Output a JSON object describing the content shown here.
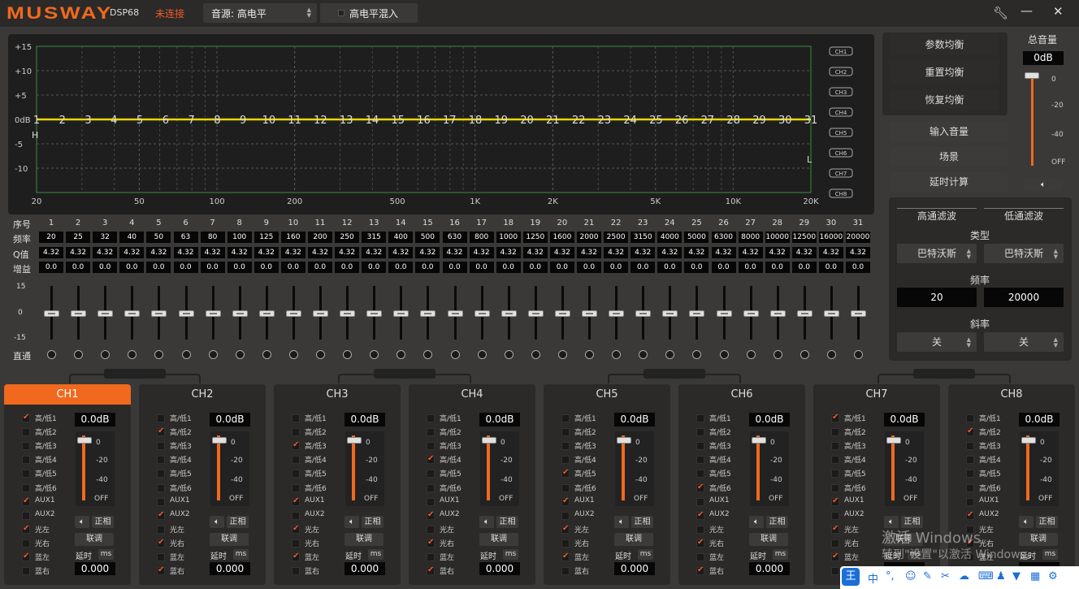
{
  "app": {
    "brand": "MUSWAY",
    "model": "DSP68",
    "status": "未连接"
  },
  "source": {
    "label": "音源:",
    "value": "高电平"
  },
  "mix_label": "高电平混入",
  "graph": {
    "y_ticks": [
      "+15",
      "+10",
      "+5",
      "0dB",
      "-5",
      "-10"
    ],
    "x_ticks": [
      "20",
      "50",
      "100",
      "200",
      "500",
      "1K",
      "2K",
      "5K",
      "10K",
      "20K"
    ],
    "hp_marker": "H",
    "lp_marker": "L",
    "ch_buttons": [
      "CH1",
      "CH2",
      "CH3",
      "CH4",
      "CH5",
      "CH6",
      "CH7",
      "CH8"
    ]
  },
  "eq_table": {
    "row_labels": [
      "序号",
      "频率",
      "Q值",
      "增益"
    ],
    "scale_labels": [
      "15",
      "0",
      "-15"
    ],
    "bypass_label": "直通",
    "bands": [
      {
        "n": "1",
        "f": "20",
        "q": "4.32",
        "g": "0.0"
      },
      {
        "n": "2",
        "f": "25",
        "q": "4.32",
        "g": "0.0"
      },
      {
        "n": "3",
        "f": "32",
        "q": "4.32",
        "g": "0.0"
      },
      {
        "n": "4",
        "f": "40",
        "q": "4.32",
        "g": "0.0"
      },
      {
        "n": "5",
        "f": "50",
        "q": "4.32",
        "g": "0.0"
      },
      {
        "n": "6",
        "f": "63",
        "q": "4.32",
        "g": "0.0"
      },
      {
        "n": "7",
        "f": "80",
        "q": "4.32",
        "g": "0.0"
      },
      {
        "n": "8",
        "f": "100",
        "q": "4.32",
        "g": "0.0"
      },
      {
        "n": "9",
        "f": "125",
        "q": "4.32",
        "g": "0.0"
      },
      {
        "n": "10",
        "f": "160",
        "q": "4.32",
        "g": "0.0"
      },
      {
        "n": "11",
        "f": "200",
        "q": "4.32",
        "g": "0.0"
      },
      {
        "n": "12",
        "f": "250",
        "q": "4.32",
        "g": "0.0"
      },
      {
        "n": "13",
        "f": "315",
        "q": "4.32",
        "g": "0.0"
      },
      {
        "n": "14",
        "f": "400",
        "q": "4.32",
        "g": "0.0"
      },
      {
        "n": "15",
        "f": "500",
        "q": "4.32",
        "g": "0.0"
      },
      {
        "n": "16",
        "f": "630",
        "q": "4.32",
        "g": "0.0"
      },
      {
        "n": "17",
        "f": "800",
        "q": "4.32",
        "g": "0.0"
      },
      {
        "n": "18",
        "f": "1000",
        "q": "4.32",
        "g": "0.0"
      },
      {
        "n": "19",
        "f": "1250",
        "q": "4.32",
        "g": "0.0"
      },
      {
        "n": "20",
        "f": "1600",
        "q": "4.32",
        "g": "0.0"
      },
      {
        "n": "21",
        "f": "2000",
        "q": "4.32",
        "g": "0.0"
      },
      {
        "n": "22",
        "f": "2500",
        "q": "4.32",
        "g": "0.0"
      },
      {
        "n": "23",
        "f": "3150",
        "q": "4.32",
        "g": "0.0"
      },
      {
        "n": "24",
        "f": "4000",
        "q": "4.32",
        "g": "0.0"
      },
      {
        "n": "25",
        "f": "5000",
        "q": "4.32",
        "g": "0.0"
      },
      {
        "n": "26",
        "f": "6300",
        "q": "4.32",
        "g": "0.0"
      },
      {
        "n": "27",
        "f": "8000",
        "q": "4.32",
        "g": "0.0"
      },
      {
        "n": "28",
        "f": "10000",
        "q": "4.32",
        "g": "0.0"
      },
      {
        "n": "29",
        "f": "12500",
        "q": "4.32",
        "g": "0.0"
      },
      {
        "n": "30",
        "f": "16000",
        "q": "4.32",
        "g": "0.0"
      },
      {
        "n": "31",
        "f": "20000",
        "q": "4.32",
        "g": "0.0"
      }
    ]
  },
  "eq_buttons": {
    "param_eq": "参数均衡",
    "reset_eq": "重置均衡",
    "restore_eq": "恢复均衡"
  },
  "master": {
    "label": "总音量",
    "value": "0dB",
    "scale": [
      "0",
      "-20",
      "-40",
      "OFF"
    ]
  },
  "side_buttons": {
    "input_volume": "输入音量",
    "scene": "场景",
    "delay_calc": "延时计算"
  },
  "filters": {
    "hp_title": "高通滤波",
    "lp_title": "低通滤波",
    "type_label": "类型",
    "hp_type": "巴特沃斯",
    "lp_type": "巴特沃斯",
    "freq_label": "频率",
    "hp_freq": "20",
    "lp_freq": "20000",
    "slope_label": "斜率",
    "hp_slope": "关",
    "lp_slope": "关"
  },
  "channel_common": {
    "inputs": [
      "高/低1",
      "高/低2",
      "高/低3",
      "高/低4",
      "高/低5",
      "高/低6",
      "AUX1",
      "AUX2",
      "光左",
      "光右",
      "蓝左",
      "蓝右"
    ],
    "phase": "正相",
    "tune": "联调",
    "delay_label": "延时",
    "delay_unit": "ms",
    "scale": [
      "0",
      "-20",
      "-40",
      "OFF"
    ]
  },
  "channels": [
    {
      "name": "CH1",
      "gain": "0.0dB",
      "delay": "0.000",
      "checks": [
        1,
        0,
        0,
        0,
        0,
        0,
        1,
        0,
        1,
        0,
        1,
        0
      ]
    },
    {
      "name": "CH2",
      "gain": "0.0dB",
      "delay": "0.000",
      "checks": [
        0,
        1,
        0,
        0,
        0,
        0,
        0,
        1,
        0,
        1,
        0,
        1
      ]
    },
    {
      "name": "CH3",
      "gain": "0.0dB",
      "delay": "0.000",
      "checks": [
        0,
        0,
        1,
        0,
        0,
        0,
        1,
        0,
        1,
        0,
        1,
        0
      ]
    },
    {
      "name": "CH4",
      "gain": "0.0dB",
      "delay": "0.000",
      "checks": [
        0,
        0,
        0,
        1,
        0,
        0,
        0,
        1,
        0,
        1,
        0,
        1
      ]
    },
    {
      "name": "CH5",
      "gain": "0.0dB",
      "delay": "0.000",
      "checks": [
        0,
        0,
        0,
        0,
        1,
        0,
        1,
        0,
        1,
        0,
        1,
        0
      ]
    },
    {
      "name": "CH6",
      "gain": "0.0dB",
      "delay": "0.000",
      "checks": [
        0,
        0,
        0,
        0,
        0,
        1,
        0,
        1,
        0,
        1,
        0,
        1
      ]
    },
    {
      "name": "CH7",
      "gain": "0.0dB",
      "delay": "",
      "checks": [
        1,
        0,
        0,
        0,
        0,
        0,
        1,
        0,
        1,
        0,
        1,
        0
      ]
    },
    {
      "name": "CH8",
      "gain": "0.0dB",
      "delay": "",
      "checks": [
        0,
        1,
        0,
        0,
        0,
        0,
        0,
        1,
        0,
        1,
        0,
        0
      ]
    }
  ],
  "watermark": {
    "line1": "激活 Windows",
    "line2": "转到\"设置\"以激活 Windows。"
  },
  "ime": {
    "label": "中"
  },
  "colors": {
    "accent": "#f0691e",
    "curve": "#e8d800",
    "grid": "#3c8c3c"
  }
}
